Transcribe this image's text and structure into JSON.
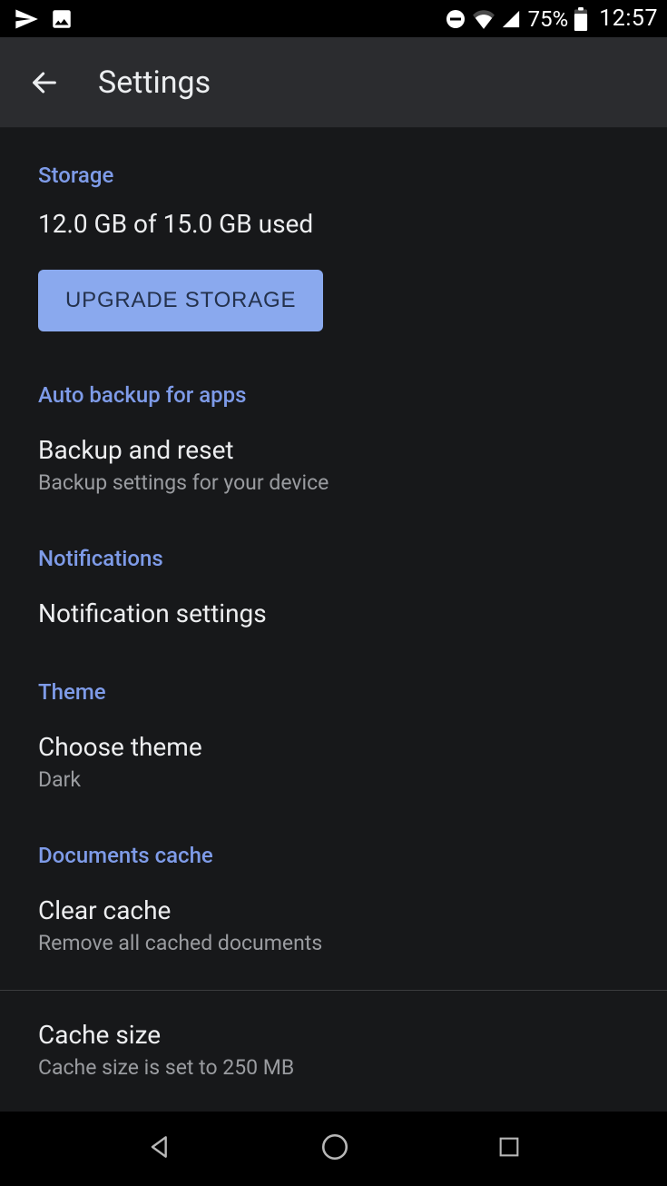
{
  "status": {
    "battery_pct": "75%",
    "time": "12:57"
  },
  "header": {
    "title": "Settings"
  },
  "sections": {
    "storage": {
      "header": "Storage",
      "usage": "12.0 GB of 15.0 GB used",
      "upgrade_label": "UPGRADE STORAGE"
    },
    "autobackup": {
      "header": "Auto backup for apps",
      "item_title": "Backup and reset",
      "item_sub": "Backup settings for your device"
    },
    "notifications": {
      "header": "Notifications",
      "item_title": "Notification settings"
    },
    "theme": {
      "header": "Theme",
      "item_title": "Choose theme",
      "item_sub": "Dark"
    },
    "cache": {
      "header": "Documents cache",
      "clear_title": "Clear cache",
      "clear_sub": "Remove all cached documents",
      "size_title": "Cache size",
      "size_sub": "Cache size is set to 250 MB"
    }
  }
}
